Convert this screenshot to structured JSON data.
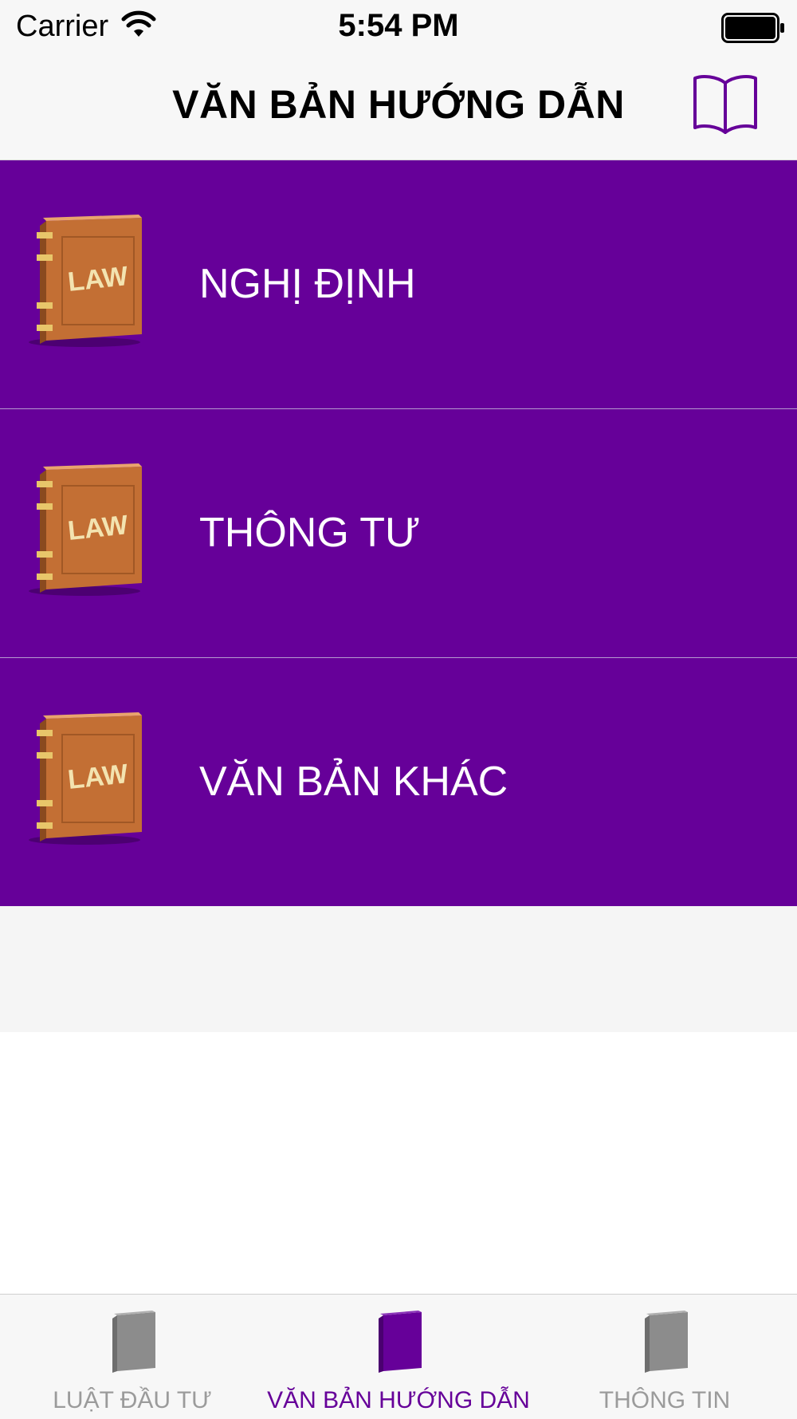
{
  "status_bar": {
    "carrier": "Carrier",
    "time": "5:54 PM"
  },
  "nav": {
    "title": "VĂN BẢN HƯỚNG DẪN",
    "icon": "book-open-icon",
    "accent": "#660099"
  },
  "list": {
    "row_color": "#660099",
    "items": [
      {
        "label": "NGHỊ ĐỊNH",
        "icon": "law-book-icon",
        "icon_text": "LAW"
      },
      {
        "label": "THÔNG TƯ",
        "icon": "law-book-icon",
        "icon_text": "LAW"
      },
      {
        "label": "VĂN BẢN KHÁC",
        "icon": "law-book-icon",
        "icon_text": "LAW"
      }
    ]
  },
  "tab_bar": {
    "tabs": [
      {
        "label": "LUẬT ĐẦU TƯ",
        "icon": "book-icon",
        "active": false
      },
      {
        "label": "VĂN BẢN HƯỚNG DẪN",
        "icon": "book-icon",
        "active": true
      },
      {
        "label": "THÔNG TIN",
        "icon": "book-icon",
        "active": false
      }
    ]
  }
}
